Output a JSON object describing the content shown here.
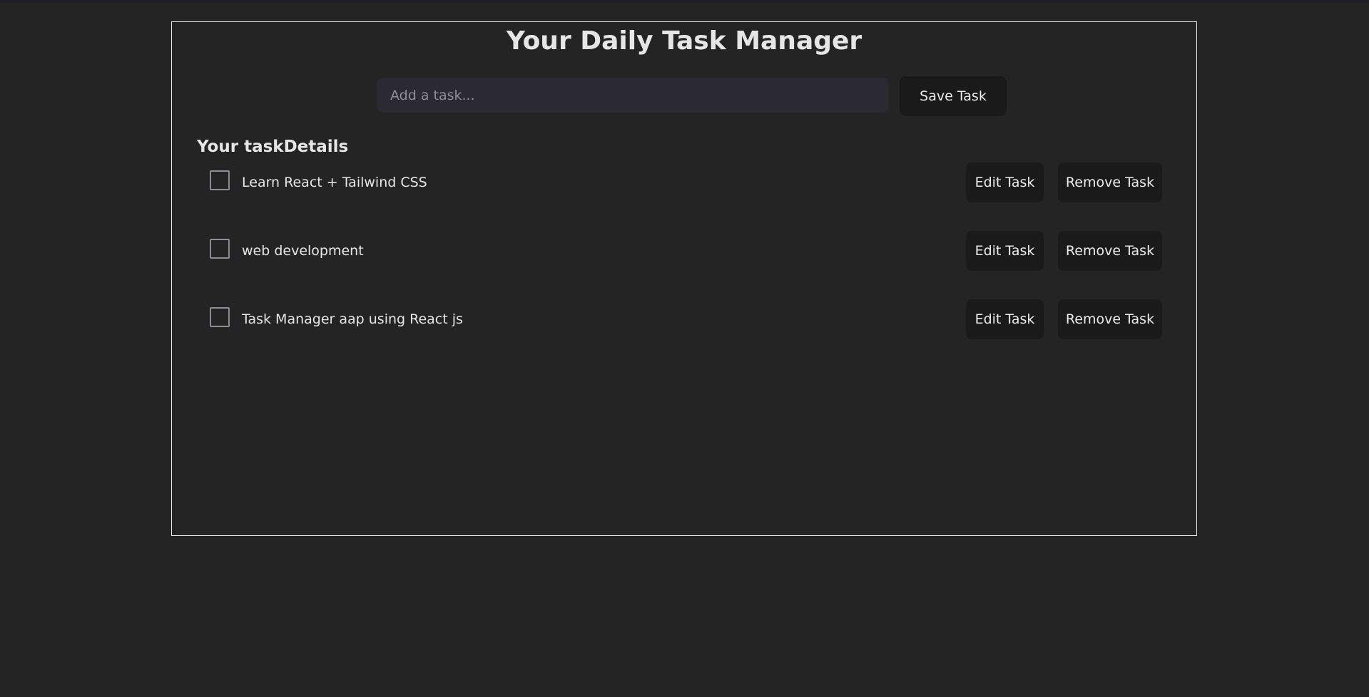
{
  "app": {
    "title": "Your Daily Task Manager"
  },
  "input": {
    "placeholder": "Add a task...",
    "value": ""
  },
  "save_button": {
    "label": "Save Task"
  },
  "list": {
    "heading": "Your taskDetails",
    "tasks": [
      {
        "text": "Learn React + Tailwind CSS",
        "completed": false,
        "edit_label": "Edit Task",
        "remove_label": "Remove Task"
      },
      {
        "text": "web development",
        "completed": false,
        "edit_label": "Edit Task",
        "remove_label": "Remove Task"
      },
      {
        "text": "Task Manager aap using React js",
        "completed": false,
        "edit_label": "Edit Task",
        "remove_label": "Remove Task"
      }
    ]
  },
  "colors": {
    "background": "#242424",
    "input_background": "#2b2a33",
    "button_background": "#1a1a1a",
    "border": "#e8e8e8"
  }
}
